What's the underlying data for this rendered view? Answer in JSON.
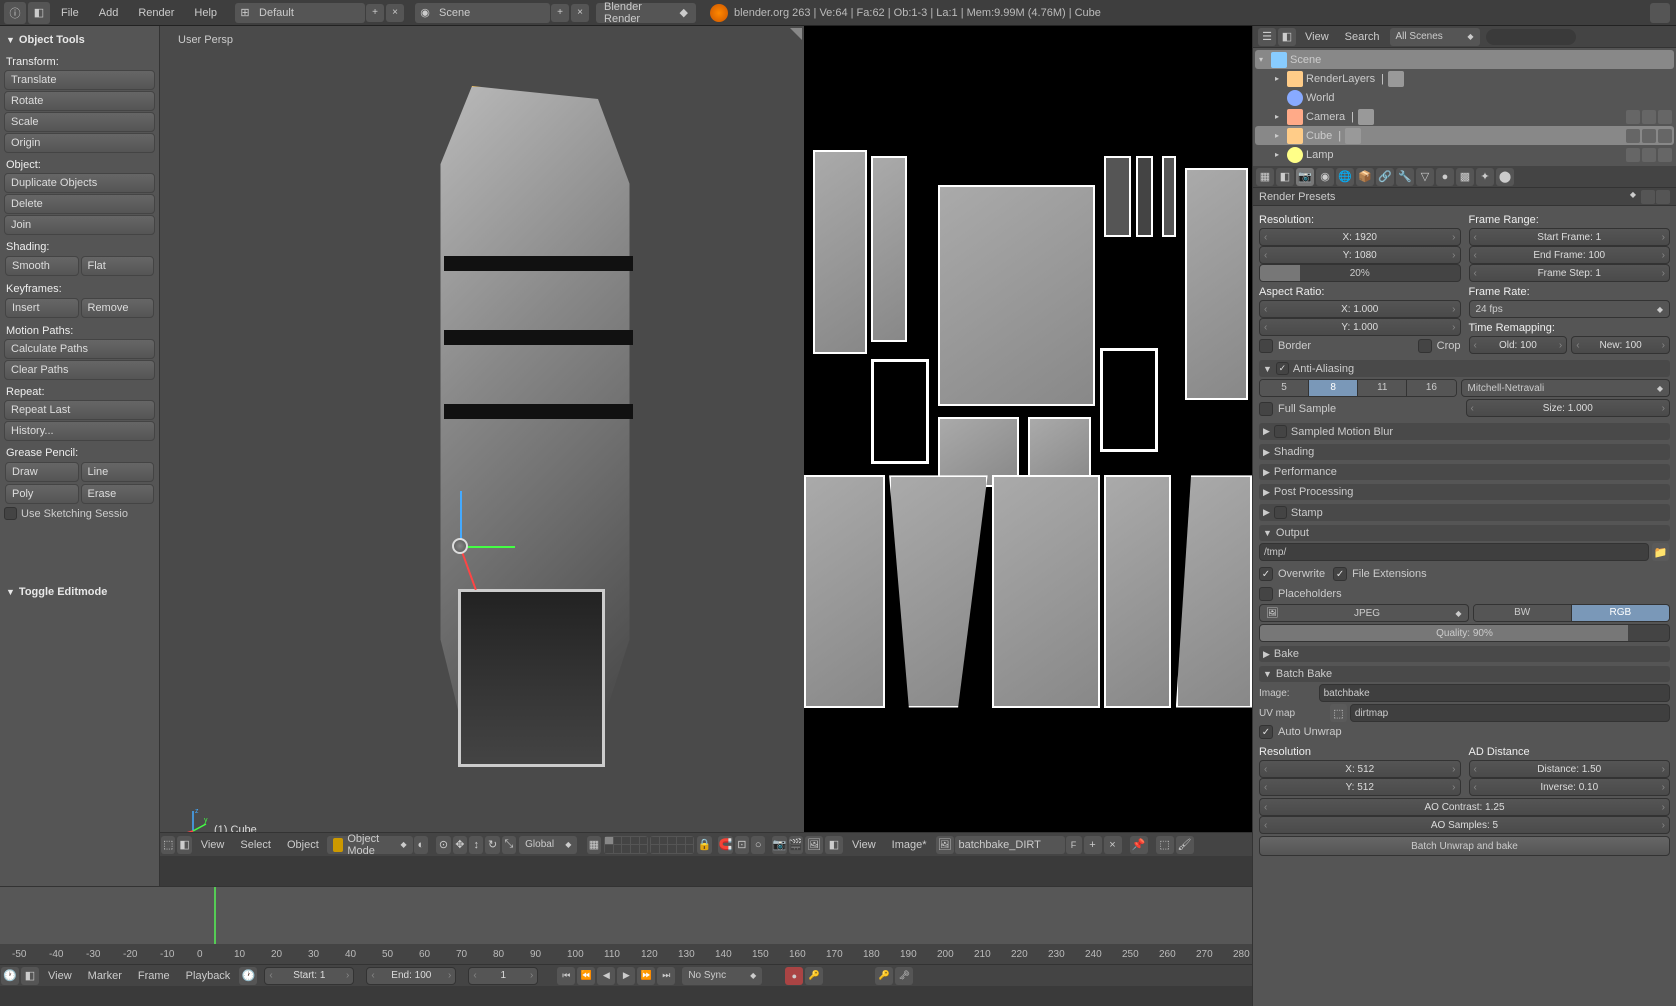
{
  "topbar": {
    "menus": [
      "File",
      "Add",
      "Render",
      "Help"
    ],
    "layout": "Default",
    "scene": "Scene",
    "engine": "Blender Render",
    "status": "blender.org 263 | Ve:64 | Fa:62 | Ob:1-3 | La:1 | Mem:9.99M (4.76M) | Cube"
  },
  "toolshelf": {
    "title": "Object Tools",
    "transform_label": "Transform:",
    "translate": "Translate",
    "rotate": "Rotate",
    "scale": "Scale",
    "origin": "Origin",
    "object_label": "Object:",
    "duplicate": "Duplicate Objects",
    "delete": "Delete",
    "join": "Join",
    "shading_label": "Shading:",
    "smooth": "Smooth",
    "flat": "Flat",
    "keyframes_label": "Keyframes:",
    "insert": "Insert",
    "remove": "Remove",
    "motion_label": "Motion Paths:",
    "calc": "Calculate Paths",
    "clear": "Clear Paths",
    "repeat_label": "Repeat:",
    "repeat_last": "Repeat Last",
    "history": "History...",
    "grease_label": "Grease Pencil:",
    "draw": "Draw",
    "line": "Line",
    "poly": "Poly",
    "erase": "Erase",
    "sketch": "Use Sketching Sessio",
    "toggle_edit": "Toggle Editmode"
  },
  "viewport": {
    "persp": "User Persp",
    "object_label": "(1) Cube",
    "menus": [
      "View",
      "Select",
      "Object"
    ],
    "mode": "Object Mode",
    "orientation": "Global"
  },
  "imgeditor": {
    "menus": [
      "View",
      "Image*"
    ],
    "image_name": "batchbake_DIRT"
  },
  "outliner": {
    "menus": [
      "View",
      "Search"
    ],
    "filter": "All Scenes",
    "search_placeholder": "",
    "items": [
      {
        "name": "Scene",
        "icon": "scene",
        "indent": 0,
        "sel": true,
        "expand": "▾"
      },
      {
        "name": "RenderLayers",
        "icon": "rl",
        "indent": 1,
        "expand": "▸",
        "extra": true
      },
      {
        "name": "World",
        "icon": "world",
        "indent": 1
      },
      {
        "name": "Camera",
        "icon": "cam",
        "indent": 1,
        "expand": "▸",
        "restrict": true,
        "extra": true
      },
      {
        "name": "Cube",
        "icon": "mesh",
        "indent": 1,
        "expand": "▸",
        "sel": true,
        "restrict": true,
        "extra": true
      },
      {
        "name": "Lamp",
        "icon": "lamp",
        "indent": 1,
        "expand": "▸",
        "restrict": true
      }
    ]
  },
  "props": {
    "preset": "Render Presets",
    "resolution_label": "Resolution:",
    "res_x": "X: 1920",
    "res_y": "Y: 1080",
    "res_pct": "20%",
    "aspect_label": "Aspect Ratio:",
    "asp_x": "X: 1.000",
    "asp_y": "Y: 1.000",
    "border": "Border",
    "crop": "Crop",
    "frame_range_label": "Frame Range:",
    "start": "Start Frame: 1",
    "end": "End Frame: 100",
    "step": "Frame Step: 1",
    "frame_rate_label": "Frame Rate:",
    "fps": "24 fps",
    "time_remap": "Time Remapping:",
    "old": "Old: 100",
    "new": "New: 100",
    "aa": "Anti-Aliasing",
    "aa_levels": [
      "5",
      "8",
      "11",
      "16"
    ],
    "aa_active": "8",
    "aa_filter": "Mitchell-Netravali",
    "full_sample": "Full Sample",
    "aa_size": "Size: 1.000",
    "smb": "Sampled Motion Blur",
    "shading": "Shading",
    "performance": "Performance",
    "postpro": "Post Processing",
    "stamp": "Stamp",
    "output": "Output",
    "output_path": "/tmp/",
    "overwrite": "Overwrite",
    "file_ext": "File Extensions",
    "placeholders": "Placeholders",
    "format": "JPEG",
    "bw": "BW",
    "rgb": "RGB",
    "quality": "Quality: 90%",
    "bake": "Bake",
    "batch_bake": "Batch Bake",
    "bb_image_lbl": "Image:",
    "bb_image": "batchbake",
    "bb_uv_lbl": "UV map",
    "bb_uv": "dirtmap",
    "auto_unwrap": "Auto Unwrap",
    "bb_res_label": "Resolution",
    "bb_x": "X: 512",
    "bb_y": "Y: 512",
    "bb_ad_label": "AD Distance",
    "bb_dist": "Distance: 1.50",
    "bb_inv": "Inverse: 0.10",
    "bb_contrast": "AO Contrast: 1.25",
    "bb_samples": "AO Samples: 5",
    "bb_btn": "Batch Unwrap and bake"
  },
  "timeline": {
    "menus": [
      "View",
      "Marker",
      "Frame",
      "Playback"
    ],
    "start": "Start: 1",
    "end": "End: 100",
    "current": "1",
    "sync": "No Sync",
    "ticks": [
      -50,
      -40,
      -30,
      -20,
      -10,
      0,
      10,
      20,
      30,
      40,
      50,
      60,
      70,
      80,
      90,
      100,
      110,
      120,
      130,
      140,
      150,
      160,
      170,
      180,
      190,
      200,
      210,
      220,
      230,
      240,
      250,
      260,
      270,
      280
    ]
  }
}
